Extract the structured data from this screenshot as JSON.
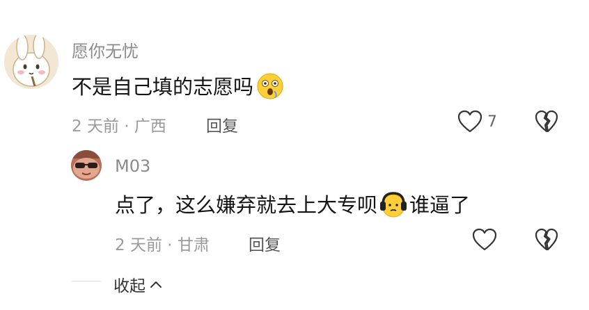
{
  "comments": [
    {
      "username": "愿你无忧",
      "text": "不是自己填的志愿吗",
      "emoji": "surprised-face-emoji",
      "time_location": "2 天前 · 广西",
      "reply_label": "回复",
      "like_count": "7"
    }
  ],
  "replies": [
    {
      "username": "M03",
      "text_before": "点了，这么嫌弃就去上大专呗",
      "emoji": "headphones-face-emoji",
      "text_after": "谁逼了",
      "time_location": "2 天前 · 甘肃",
      "reply_label": "回复"
    }
  ],
  "collapse_label": "收起",
  "icons": {
    "like": "heart-outline-icon",
    "dislike": "broken-heart-icon",
    "collapse": "chevron-up-icon"
  },
  "colors": {
    "text": "#141414",
    "meta": "#9a9a9a",
    "icon": "#333333"
  }
}
